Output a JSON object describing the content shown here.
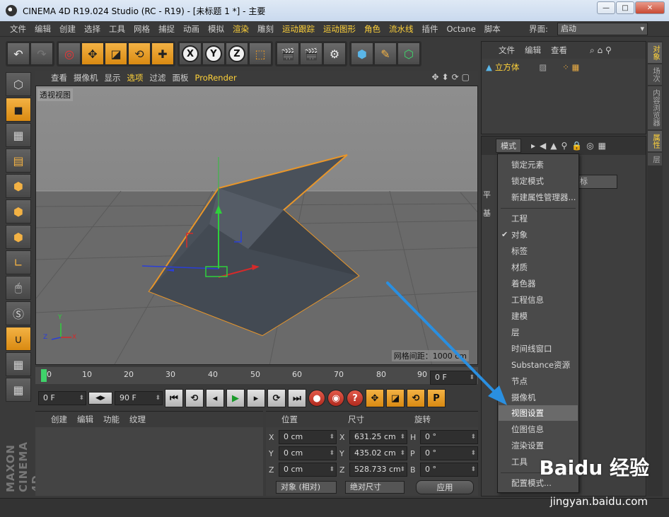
{
  "window": {
    "title": "CINEMA 4D R19.024 Studio (RC - R19) - [未标题 1 *] - 主要",
    "min_label": "—",
    "max_label": "□",
    "close_label": "✕"
  },
  "menubar": {
    "items": [
      "文件",
      "编辑",
      "创建",
      "选择",
      "工具",
      "网格",
      "捕捉",
      "动画",
      "模拟",
      "渲染",
      "雕刻",
      "运动跟踪",
      "运动图形",
      "角色",
      "流水线",
      "插件",
      "Octane",
      "脚本"
    ],
    "highlighted": [
      "渲染",
      "运动跟踪",
      "运动图形",
      "角色",
      "流水线"
    ],
    "layout_label": "界面:",
    "layout_value": "启动"
  },
  "viewport": {
    "menu": [
      "查看",
      "摄像机",
      "显示",
      "选项",
      "过滤",
      "面板",
      "ProRender"
    ],
    "highlighted_menu": "选项",
    "label": "透视视图",
    "grid_spacing": "网格间距：1000 cm",
    "axis_labels": {
      "y": "Y",
      "z": "Z",
      "x": "X"
    }
  },
  "timeline": {
    "ticks": [
      "0",
      "10",
      "20",
      "30",
      "40",
      "50",
      "60",
      "70",
      "80",
      "90"
    ],
    "current_frame": "0 F"
  },
  "playback": {
    "start_frame": "0 F",
    "end_frame": "90 F"
  },
  "materials": {
    "menu": [
      "创建",
      "编辑",
      "功能",
      "纹理"
    ]
  },
  "coordinates": {
    "headers": {
      "position": "位置",
      "size": "尺寸",
      "rotation": "旋转"
    },
    "rows": [
      {
        "pos_axis": "X",
        "pos": "0 cm",
        "size_axis": "X",
        "size": "631.25 cm",
        "rot_axis": "H",
        "rot": "0 °"
      },
      {
        "pos_axis": "Y",
        "pos": "0 cm",
        "size_axis": "Y",
        "size": "435.02 cm",
        "rot_axis": "P",
        "rot": "0 °"
      },
      {
        "pos_axis": "Z",
        "pos": "0 cm",
        "size_axis": "Z",
        "size": "528.733 cm",
        "rot_axis": "B",
        "rot": "0 °"
      }
    ],
    "mode": "对象 (相对)",
    "size_mode": "绝对尺寸",
    "apply": "应用"
  },
  "objects": {
    "menu": [
      "文件",
      "编辑",
      "查看"
    ],
    "items": [
      {
        "name": "立方体"
      }
    ]
  },
  "attributes": {
    "mode_label": "模式",
    "partial_labels": {
      "coord": "标",
      "tab1": "平",
      "tab2": "基"
    }
  },
  "sidetabs": [
    "对象",
    "场次",
    "内容浏览器",
    "属性",
    "层"
  ],
  "dropdown": {
    "items": [
      {
        "label": "锁定元素"
      },
      {
        "label": "锁定模式"
      },
      {
        "label": "新建属性管理器..."
      },
      {
        "label": "工程"
      },
      {
        "label": "对象",
        "checked": true
      },
      {
        "label": "标签"
      },
      {
        "label": "材质"
      },
      {
        "label": "着色器"
      },
      {
        "label": "工程信息"
      },
      {
        "label": "建模"
      },
      {
        "label": "层"
      },
      {
        "label": "时间线窗口"
      },
      {
        "label": "Substance资源"
      },
      {
        "label": "节点"
      },
      {
        "label": "摄像机"
      },
      {
        "label": "视图设置",
        "selected": true
      },
      {
        "label": "位图信息"
      },
      {
        "label": "渲染设置"
      },
      {
        "label": "工具"
      },
      {
        "label": "配置模式..."
      }
    ]
  },
  "branding": {
    "maxon": "MAXON CINEMA 4D",
    "watermark": "Baidu 经验",
    "watermark_url": "jingyan.baidu.com"
  },
  "colors": {
    "accent": "#ffd23a",
    "orange_button": "#e89a1f",
    "arrow": "#2a8fe0",
    "viewport_bg": "#8a8a8a"
  }
}
